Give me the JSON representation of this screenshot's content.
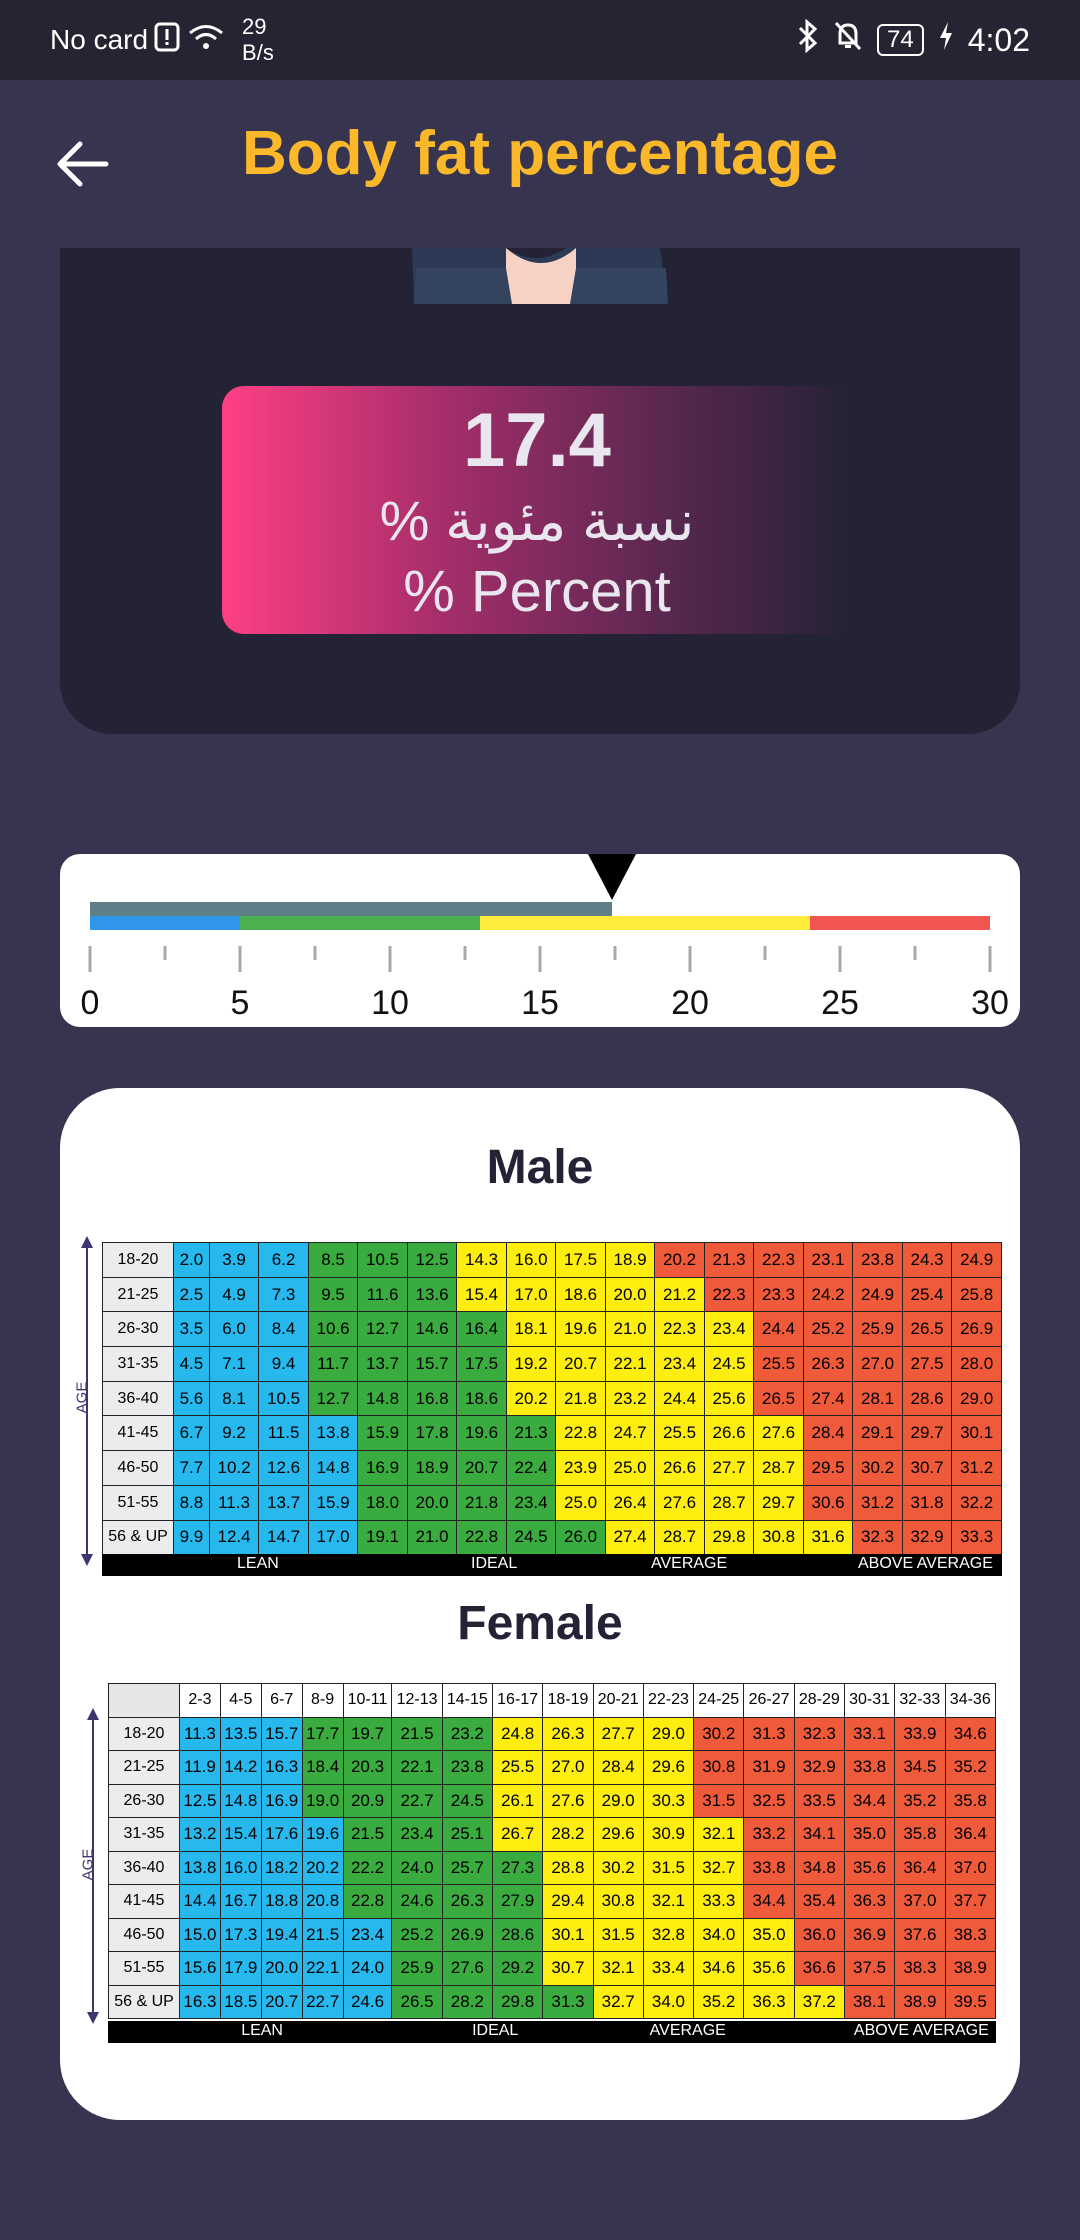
{
  "status_bar": {
    "carrier": "No card",
    "net_rate_value": "29",
    "net_rate_unit": "B/s",
    "battery": "74",
    "time": "4:02"
  },
  "header": {
    "title": "Body fat percentage"
  },
  "result": {
    "value": "17.4",
    "label_ar": "نسبة مئوية %",
    "label_en": "% Percent"
  },
  "gauge": {
    "value": 17.4,
    "min": 0,
    "max": 30,
    "tick_labels": [
      "0",
      "5",
      "10",
      "15",
      "20",
      "25",
      "30"
    ],
    "bands": [
      {
        "from": 0,
        "to": 5,
        "color": "#2f96e9"
      },
      {
        "from": 5,
        "to": 13,
        "color": "#4caf50"
      },
      {
        "from": 13,
        "to": 24,
        "color": "#ffeb3b"
      },
      {
        "from": 24,
        "to": 30,
        "color": "#f05552"
      }
    ],
    "progress_color": "#5f7f88"
  },
  "male": {
    "title": "Male",
    "age_axis_label": "AGE",
    "categories": [
      "LEAN",
      "IDEAL",
      "AVERAGE",
      "ABOVE AVERAGE"
    ],
    "rows": [
      {
        "age": "18-20",
        "values": [
          "2.0",
          "3.9",
          "6.2",
          "8.5",
          "10.5",
          "12.5",
          "14.3",
          "16.0",
          "17.5",
          "18.9",
          "20.2",
          "21.3",
          "22.3",
          "23.1",
          "23.8",
          "24.3",
          "24.9"
        ]
      },
      {
        "age": "21-25",
        "values": [
          "2.5",
          "4.9",
          "7.3",
          "9.5",
          "11.6",
          "13.6",
          "15.4",
          "17.0",
          "18.6",
          "20.0",
          "21.2",
          "22.3",
          "23.3",
          "24.2",
          "24.9",
          "25.4",
          "25.8"
        ]
      },
      {
        "age": "26-30",
        "values": [
          "3.5",
          "6.0",
          "8.4",
          "10.6",
          "12.7",
          "14.6",
          "16.4",
          "18.1",
          "19.6",
          "21.0",
          "22.3",
          "23.4",
          "24.4",
          "25.2",
          "25.9",
          "26.5",
          "26.9"
        ]
      },
      {
        "age": "31-35",
        "values": [
          "4.5",
          "7.1",
          "9.4",
          "11.7",
          "13.7",
          "15.7",
          "17.5",
          "19.2",
          "20.7",
          "22.1",
          "23.4",
          "24.5",
          "25.5",
          "26.3",
          "27.0",
          "27.5",
          "28.0"
        ]
      },
      {
        "age": "36-40",
        "values": [
          "5.6",
          "8.1",
          "10.5",
          "12.7",
          "14.8",
          "16.8",
          "18.6",
          "20.2",
          "21.8",
          "23.2",
          "24.4",
          "25.6",
          "26.5",
          "27.4",
          "28.1",
          "28.6",
          "29.0"
        ]
      },
      {
        "age": "41-45",
        "values": [
          "6.7",
          "9.2",
          "11.5",
          "13.8",
          "15.9",
          "17.8",
          "19.6",
          "21.3",
          "22.8",
          "24.7",
          "25.5",
          "26.6",
          "27.6",
          "28.4",
          "29.1",
          "29.7",
          "30.1"
        ]
      },
      {
        "age": "46-50",
        "values": [
          "7.7",
          "10.2",
          "12.6",
          "14.8",
          "16.9",
          "18.9",
          "20.7",
          "22.4",
          "23.9",
          "25.0",
          "26.6",
          "27.7",
          "28.7",
          "29.5",
          "30.2",
          "30.7",
          "31.2"
        ]
      },
      {
        "age": "51-55",
        "values": [
          "8.8",
          "11.3",
          "13.7",
          "15.9",
          "18.0",
          "20.0",
          "21.8",
          "23.4",
          "25.0",
          "26.4",
          "27.6",
          "28.7",
          "29.7",
          "30.6",
          "31.2",
          "31.8",
          "32.2"
        ]
      },
      {
        "age": "56 & UP",
        "values": [
          "9.9",
          "12.4",
          "14.7",
          "17.0",
          "19.1",
          "21.0",
          "22.8",
          "24.5",
          "26.0",
          "27.4",
          "28.7",
          "29.8",
          "30.8",
          "31.6",
          "32.3",
          "32.9",
          "33.3"
        ]
      }
    ],
    "color_bounds": [
      [
        3,
        6,
        10,
        16
      ],
      [
        3,
        6,
        11,
        16
      ],
      [
        3,
        7,
        12,
        16
      ],
      [
        3,
        7,
        12,
        16
      ],
      [
        3,
        7,
        12,
        16
      ],
      [
        4,
        8,
        13,
        16
      ],
      [
        4,
        8,
        13,
        16
      ],
      [
        4,
        8,
        13,
        16
      ],
      [
        4,
        9,
        14,
        16
      ]
    ]
  },
  "female": {
    "title": "Female",
    "age_axis_label": "AGE",
    "categories": [
      "LEAN",
      "IDEAL",
      "AVERAGE",
      "ABOVE AVERAGE"
    ],
    "col_headers": [
      "2-3",
      "4-5",
      "6-7",
      "8-9",
      "10-11",
      "12-13",
      "14-15",
      "16-17",
      "18-19",
      "20-21",
      "22-23",
      "24-25",
      "26-27",
      "28-29",
      "30-31",
      "32-33",
      "34-36"
    ],
    "rows": [
      {
        "age": "18-20",
        "values": [
          "11.3",
          "13.5",
          "15.7",
          "17.7",
          "19.7",
          "21.5",
          "23.2",
          "24.8",
          "26.3",
          "27.7",
          "29.0",
          "30.2",
          "31.3",
          "32.3",
          "33.1",
          "33.9",
          "34.6"
        ]
      },
      {
        "age": "21-25",
        "values": [
          "11.9",
          "14.2",
          "16.3",
          "18.4",
          "20.3",
          "22.1",
          "23.8",
          "25.5",
          "27.0",
          "28.4",
          "29.6",
          "30.8",
          "31.9",
          "32.9",
          "33.8",
          "34.5",
          "35.2"
        ]
      },
      {
        "age": "26-30",
        "values": [
          "12.5",
          "14.8",
          "16.9",
          "19.0",
          "20.9",
          "22.7",
          "24.5",
          "26.1",
          "27.6",
          "29.0",
          "30.3",
          "31.5",
          "32.5",
          "33.5",
          "34.4",
          "35.2",
          "35.8"
        ]
      },
      {
        "age": "31-35",
        "values": [
          "13.2",
          "15.4",
          "17.6",
          "19.6",
          "21.5",
          "23.4",
          "25.1",
          "26.7",
          "28.2",
          "29.6",
          "30.9",
          "32.1",
          "33.2",
          "34.1",
          "35.0",
          "35.8",
          "36.4"
        ]
      },
      {
        "age": "36-40",
        "values": [
          "13.8",
          "16.0",
          "18.2",
          "20.2",
          "22.2",
          "24.0",
          "25.7",
          "27.3",
          "28.8",
          "30.2",
          "31.5",
          "32.7",
          "33.8",
          "34.8",
          "35.6",
          "36.4",
          "37.0"
        ]
      },
      {
        "age": "41-45",
        "values": [
          "14.4",
          "16.7",
          "18.8",
          "20.8",
          "22.8",
          "24.6",
          "26.3",
          "27.9",
          "29.4",
          "30.8",
          "32.1",
          "33.3",
          "34.4",
          "35.4",
          "36.3",
          "37.0",
          "37.7"
        ]
      },
      {
        "age": "46-50",
        "values": [
          "15.0",
          "17.3",
          "19.4",
          "21.5",
          "23.4",
          "25.2",
          "26.9",
          "28.6",
          "30.1",
          "31.5",
          "32.8",
          "34.0",
          "35.0",
          "36.0",
          "36.9",
          "37.6",
          "38.3"
        ]
      },
      {
        "age": "51-55",
        "values": [
          "15.6",
          "17.9",
          "20.0",
          "22.1",
          "24.0",
          "25.9",
          "27.6",
          "29.2",
          "30.7",
          "32.1",
          "33.4",
          "34.6",
          "35.6",
          "36.6",
          "37.5",
          "38.3",
          "38.9"
        ]
      },
      {
        "age": "56 & UP",
        "values": [
          "16.3",
          "18.5",
          "20.7",
          "22.7",
          "24.6",
          "26.5",
          "28.2",
          "29.8",
          "31.3",
          "32.7",
          "34.0",
          "35.2",
          "36.3",
          "37.2",
          "38.1",
          "38.9",
          "39.5"
        ]
      }
    ],
    "color_bounds": [
      [
        3,
        7,
        11,
        16
      ],
      [
        3,
        7,
        11,
        16
      ],
      [
        3,
        7,
        11,
        16
      ],
      [
        4,
        7,
        12,
        16
      ],
      [
        4,
        8,
        12,
        16
      ],
      [
        4,
        8,
        12,
        16
      ],
      [
        5,
        8,
        13,
        16
      ],
      [
        5,
        8,
        13,
        16
      ],
      [
        5,
        9,
        14,
        16
      ]
    ]
  }
}
